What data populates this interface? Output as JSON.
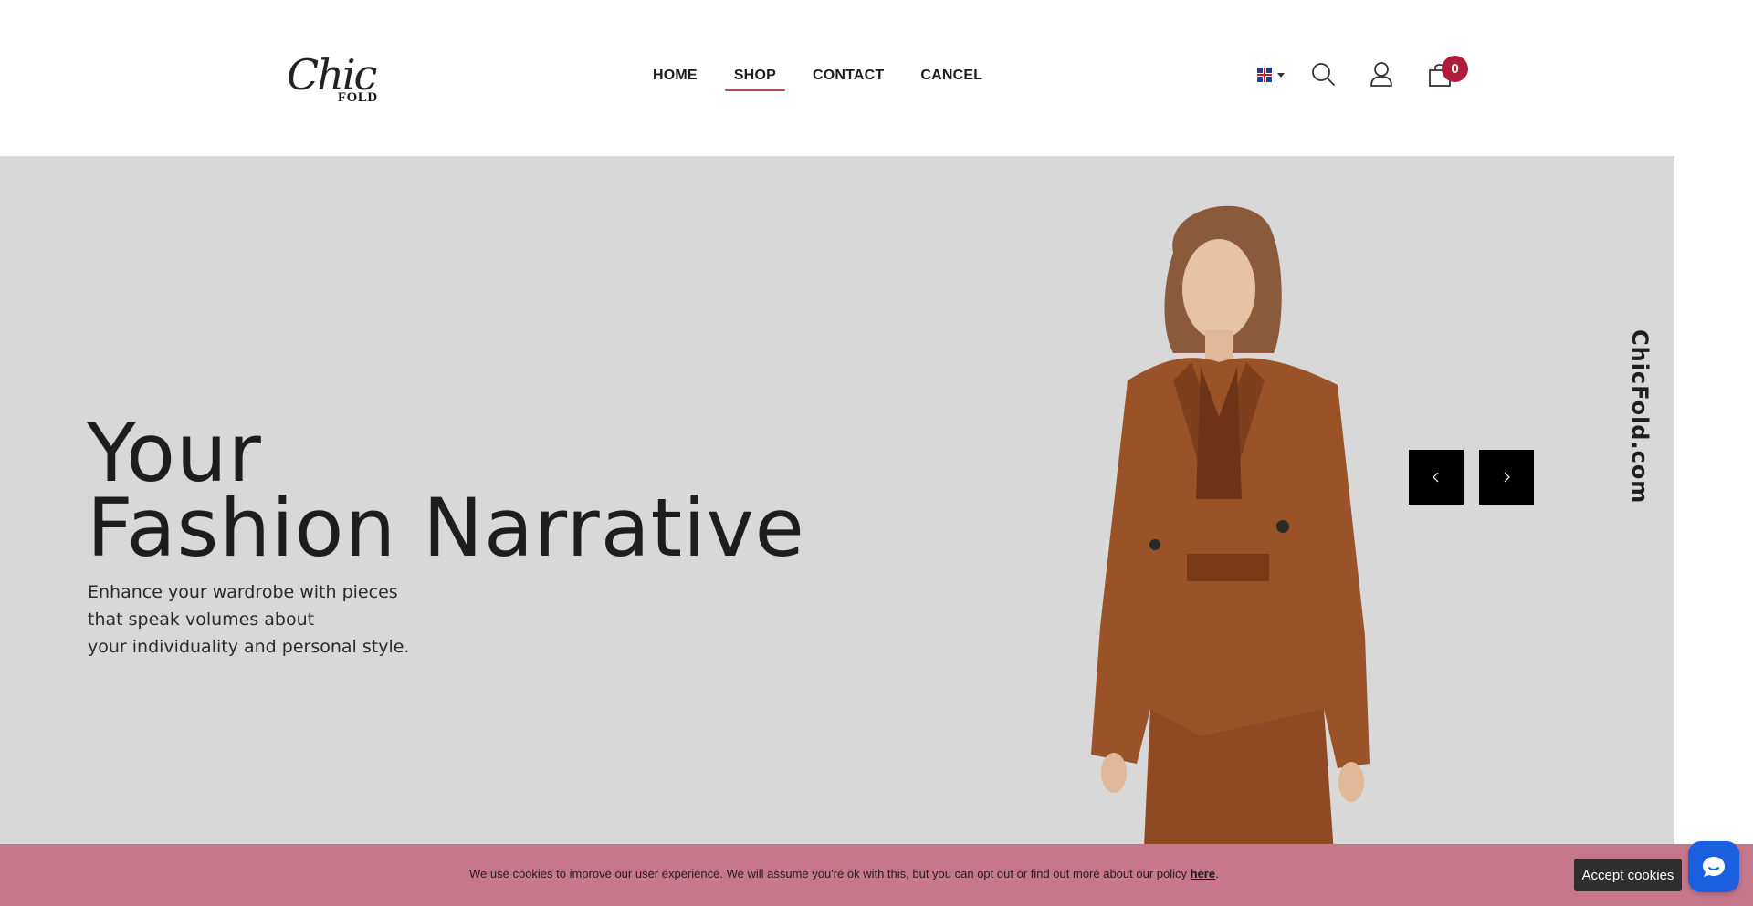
{
  "brand": {
    "script": "Chic",
    "word": "FOLD"
  },
  "nav": {
    "items": [
      {
        "label": "HOME"
      },
      {
        "label": "SHOP",
        "active": true
      },
      {
        "label": "CONTACT"
      },
      {
        "label": "CANCEL"
      }
    ]
  },
  "header": {
    "language_icon": "uk-flag-icon",
    "search_icon": "search-icon",
    "user_icon": "user-icon",
    "cart_icon": "cart-icon",
    "cart_count": "0"
  },
  "hero": {
    "title_line1": "Your",
    "title_line2": "Fashion Narrative",
    "subtitle_line1": "Enhance your wardrobe with pieces",
    "subtitle_line2": "that speak volumes about",
    "subtitle_line3": "your individuality and personal style.",
    "side_text": "ChicFold.com",
    "prev_icon": "chevron-left-icon",
    "next_icon": "chevron-right-icon"
  },
  "cookie": {
    "text": "We use cookies to improve our user experience. We will assume you're ok with this, but you can opt out or find out more about our policy ",
    "link": "here",
    "end": ".",
    "accept": "Accept cookies"
  },
  "chat": {
    "icon": "chat-icon"
  },
  "colors": {
    "accent": "#b5435a",
    "badge": "#b01c3a",
    "hero_bg": "#d8d8d8",
    "cookie_bg": "#c6778c",
    "chat": "#1a5fe0"
  }
}
